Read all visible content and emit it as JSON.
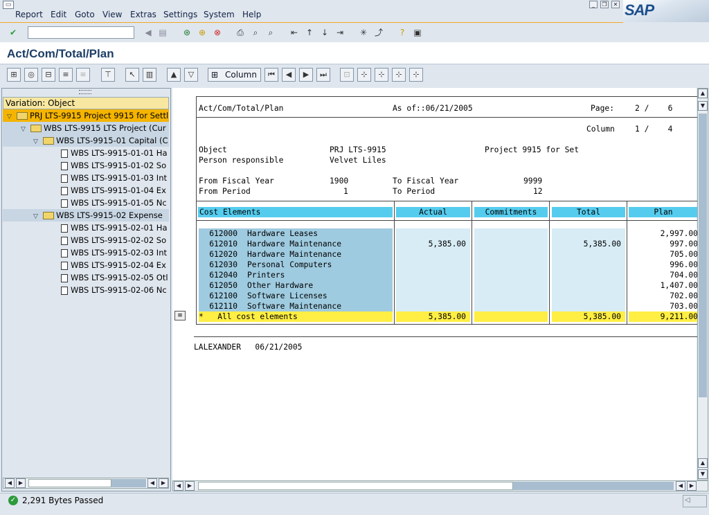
{
  "menu": {
    "items": [
      "Report",
      "Edit",
      "Goto",
      "View",
      "Extras",
      "Settings",
      "System",
      "Help"
    ]
  },
  "brand": {
    "logo_text": "SAP"
  },
  "command_field": {
    "value": ""
  },
  "page_title": "Act/Com/Total/Plan",
  "app_toolbar": {
    "column_label": "Column"
  },
  "tree": {
    "header": "Variation: Object",
    "nodes": [
      {
        "label": "PRJ LTS-9915 Project 9915 for Settl",
        "type": "folder",
        "level": 0,
        "selected": true
      },
      {
        "label": "WBS LTS-9915 LTS Project (Cur",
        "type": "folder",
        "level": 1
      },
      {
        "label": "WBS LTS-9915-01 Capital (C",
        "type": "folder",
        "level": 2
      },
      {
        "label": "WBS LTS-9915-01-01 Ha",
        "type": "doc",
        "level": 3
      },
      {
        "label": "WBS LTS-9915-01-02 So",
        "type": "doc",
        "level": 3
      },
      {
        "label": "WBS LTS-9915-01-03 Int",
        "type": "doc",
        "level": 3
      },
      {
        "label": "WBS LTS-9915-01-04 Ex",
        "type": "doc",
        "level": 3
      },
      {
        "label": "WBS LTS-9915-01-05 Nc",
        "type": "doc",
        "level": 3
      },
      {
        "label": "WBS LTS-9915-02 Expense",
        "type": "folder",
        "level": 2
      },
      {
        "label": "WBS LTS-9915-02-01 Ha",
        "type": "doc",
        "level": 3
      },
      {
        "label": "WBS LTS-9915-02-02 So",
        "type": "doc",
        "level": 3
      },
      {
        "label": "WBS LTS-9915-02-03 Int",
        "type": "doc",
        "level": 3
      },
      {
        "label": "WBS LTS-9915-02-04 Ex",
        "type": "doc",
        "level": 3
      },
      {
        "label": "WBS LTS-9915-02-05 Otl",
        "type": "doc",
        "level": 3
      },
      {
        "label": "WBS LTS-9915-02-06 Nc",
        "type": "doc",
        "level": 3
      }
    ]
  },
  "report": {
    "title": "Act/Com/Total/Plan",
    "as_of_label": "As of::06/21/2005",
    "page_label": "Page:",
    "page_value": "2 /    6",
    "column_label": "Column",
    "column_value": "1 /    4",
    "object_label": "Object",
    "object_value": "PRJ LTS-9915",
    "object_desc": "Project 9915 for Set",
    "person_label": "Person responsible",
    "person_value": "Velvet Liles",
    "from_fy_label": "From Fiscal Year",
    "from_fy_value": "1900",
    "to_fy_label": "To Fiscal Year",
    "to_fy_value": "9999",
    "from_period_label": "From Period",
    "from_period_value": "1",
    "to_period_label": "To Period",
    "to_period_value": "12",
    "columns": [
      "Cost Elements",
      "Actual",
      "Commitments",
      "Total",
      "Plan"
    ],
    "rows": [
      {
        "ce": "612000",
        "name": "Hardware Leases",
        "actual": "",
        "commit": "",
        "total": "",
        "plan": "2,997.00"
      },
      {
        "ce": "612010",
        "name": "Hardware Maintenance",
        "actual": "5,385.00",
        "commit": "",
        "total": "5,385.00",
        "plan": "997.00"
      },
      {
        "ce": "612020",
        "name": "Hardware Maintenance",
        "actual": "",
        "commit": "",
        "total": "",
        "plan": "705.00"
      },
      {
        "ce": "612030",
        "name": "Personal Computers",
        "actual": "",
        "commit": "",
        "total": "",
        "plan": "996.00"
      },
      {
        "ce": "612040",
        "name": "Printers",
        "actual": "",
        "commit": "",
        "total": "",
        "plan": "704.00"
      },
      {
        "ce": "612050",
        "name": "Other Hardware",
        "actual": "",
        "commit": "",
        "total": "",
        "plan": "1,407.00"
      },
      {
        "ce": "612100",
        "name": "Software Licenses",
        "actual": "",
        "commit": "",
        "total": "",
        "plan": "702.00"
      },
      {
        "ce": "612110",
        "name": "Software Maintenance",
        "actual": "",
        "commit": "",
        "total": "",
        "plan": "703.00"
      }
    ],
    "total_row": {
      "label": "*   All cost elements",
      "actual": "5,385.00",
      "commit": "",
      "total": "5,385.00",
      "plan": "9,211.00"
    },
    "footer": "LALEXANDER   06/21/2005"
  },
  "status": {
    "text": "2,291 Bytes Passed"
  },
  "colors": {
    "accent": "#f5a623",
    "header_cyan": "#55ccee",
    "total_yellow": "#ffee44",
    "title_blue": "#1d3e66"
  }
}
